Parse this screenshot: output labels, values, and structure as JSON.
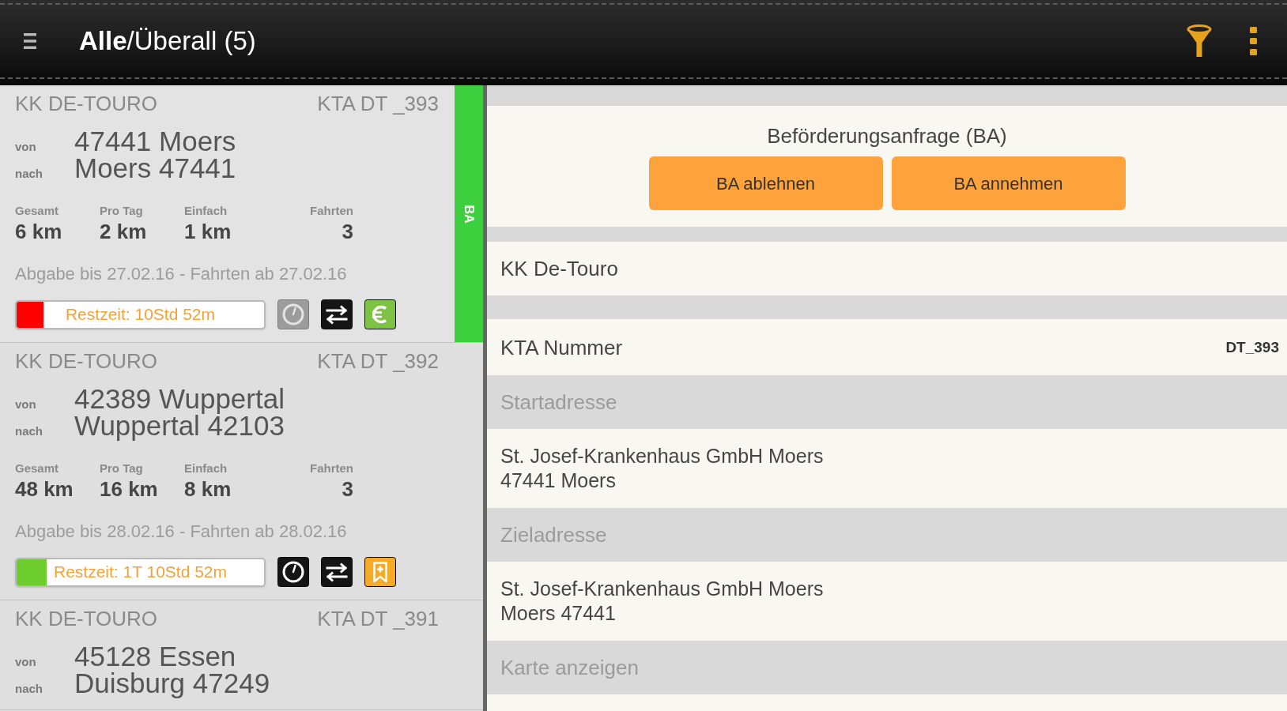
{
  "header": {
    "title": "**Alle**/Überall (5)"
  },
  "requests": [
    {
      "insurer": "KK DE-TOURO",
      "kta": "KTA DT _393",
      "selected": true,
      "tag": "BA",
      "route": [
        {
          "label": "von",
          "place": "47441 Moers"
        },
        {
          "label": "nach",
          "place": "Moers 47441"
        }
      ],
      "stats": [
        {
          "label": "Gesamt",
          "value": "6 km"
        },
        {
          "label": "Pro Tag",
          "value": "2 km"
        },
        {
          "label": "Einfach",
          "value": "1 km"
        },
        {
          "label": "Fahrten",
          "value": "3"
        }
      ],
      "dates": "Abgabe bis 27.02.16 - Fahrten ab 27.02.16",
      "remaining": {
        "text": "Restzeit: 10Std 52m",
        "level": 0.11,
        "color": "#ff0000"
      },
      "actions": [
        {
          "kind": "clock",
          "disabled": true
        },
        {
          "kind": "transfer",
          "disabled": false
        },
        {
          "kind": "euro",
          "disabled": false
        }
      ]
    },
    {
      "insurer": "KK DE-TOURO",
      "kta": "KTA DT _392",
      "selected": false,
      "route": [
        {
          "label": "von",
          "place": "42389 Wuppertal"
        },
        {
          "label": "nach",
          "place": "Wuppertal 42103"
        }
      ],
      "stats": [
        {
          "label": "Gesamt",
          "value": "48 km"
        },
        {
          "label": "Pro Tag",
          "value": "16 km"
        },
        {
          "label": "Einfach",
          "value": "8 km"
        },
        {
          "label": "Fahrten",
          "value": "3"
        }
      ],
      "dates": "Abgabe bis 28.02.16 - Fahrten ab 28.02.16",
      "remaining": {
        "text": "Restzeit: 1T 10Std 52m",
        "level": 0.12,
        "color": "#6dcc2e"
      },
      "actions": [
        {
          "kind": "clock",
          "disabled": false
        },
        {
          "kind": "transfer",
          "disabled": false
        },
        {
          "kind": "bookmark",
          "disabled": false
        }
      ]
    },
    {
      "insurer": "KK DE-TOURO",
      "kta": "KTA DT _391",
      "selected": false,
      "route": [
        {
          "label": "von",
          "place": "45128 Essen"
        },
        {
          "label": "nach",
          "place": "Duisburg 47249"
        }
      ]
    }
  ],
  "detail": {
    "title": "Beförderungsanfrage (BA)",
    "buttons": [
      "BA ablehnen",
      "BA annehmen"
    ],
    "rows": [
      {
        "kind": "value",
        "text": "KK De-Touro"
      },
      {
        "kind": "field",
        "label": "KTA Nummer",
        "value": "DT_393"
      },
      {
        "kind": "heading",
        "text": "Startadresse"
      },
      {
        "kind": "address",
        "lines": [
          "St. Josef-Krankenhaus GmbH Moers",
          "47441 Moers"
        ]
      },
      {
        "kind": "heading",
        "text": "Zieladresse"
      },
      {
        "kind": "address",
        "lines": [
          "St. Josef-Krankenhaus GmbH Moers",
          "Moers 47441"
        ]
      },
      {
        "kind": "heading",
        "text": "Karte anzeigen"
      }
    ]
  }
}
